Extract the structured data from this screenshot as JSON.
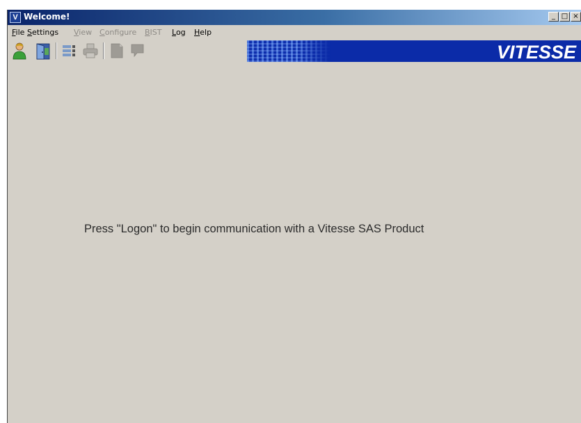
{
  "window": {
    "title": "Welcome!",
    "app_icon_glyph": "V",
    "controls": {
      "minimize": "_",
      "maximize": "□",
      "close": "×"
    }
  },
  "menubar": {
    "items": [
      {
        "label": "File",
        "accel": "F",
        "rest": "ile",
        "enabled": true
      },
      {
        "label": "Settings",
        "accel": "S",
        "rest": "ettings",
        "enabled": true
      },
      {
        "label": "View",
        "accel": "V",
        "rest": "iew",
        "enabled": false
      },
      {
        "label": "Configure",
        "accel": "C",
        "rest": "onfigure",
        "enabled": false
      },
      {
        "label": "BIST",
        "accel": "B",
        "rest": "IST",
        "enabled": false
      },
      {
        "label": "Log",
        "accel": "L",
        "rest": "og",
        "enabled": true
      },
      {
        "label": "Help",
        "accel": "H",
        "rest": "elp",
        "enabled": true
      }
    ]
  },
  "toolbar": {
    "buttons": [
      {
        "icon": "user-logon-icon",
        "enabled": true
      },
      {
        "icon": "door-logoff-icon",
        "enabled": true
      },
      {
        "icon": "list-details-icon",
        "enabled": true
      },
      {
        "icon": "printer-icon",
        "enabled": false
      },
      {
        "icon": "document-icon",
        "enabled": false
      },
      {
        "icon": "speech-bubble-icon",
        "enabled": false
      }
    ]
  },
  "brand": {
    "logo_text": "VITESSE",
    "color": "#0b2ba8"
  },
  "main": {
    "message": "Press \"Logon\" to begin communication with a Vitesse SAS Product"
  },
  "colors": {
    "window_bg": "#d4d0c8",
    "title_start": "#0a246a",
    "title_end": "#a6caf0",
    "disabled_text": "#8d8a85"
  }
}
